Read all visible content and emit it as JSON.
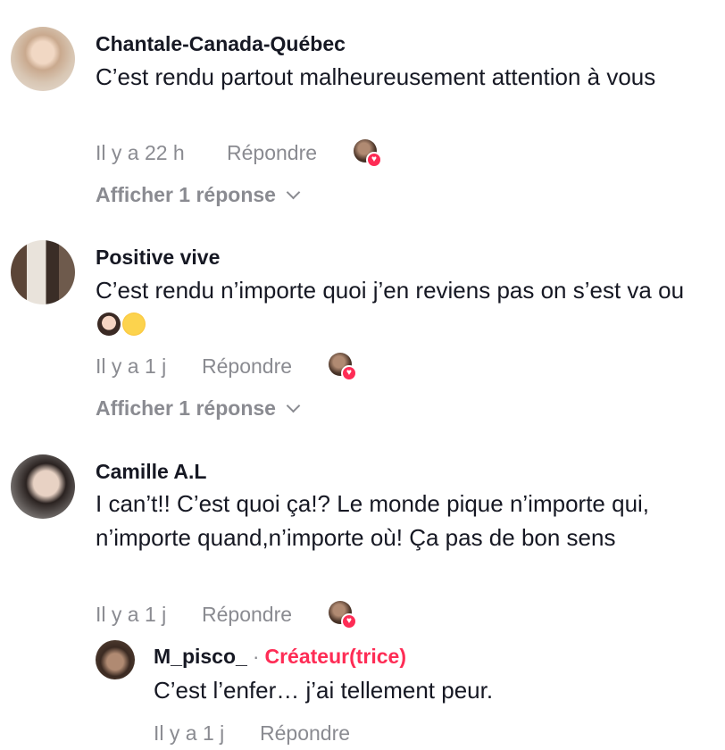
{
  "comments": [
    {
      "username": "Chantale-Canada-Québec",
      "text": "C’est rendu partout malheureusement attention à vous",
      "time": "Il y a 22 h",
      "reply": "Répondre",
      "view_replies": "Afficher 1 réponse"
    },
    {
      "username": "Positive vive",
      "text": "C’est rendu n’importe quoi j’en reviens pas on s’est va ou",
      "emojis": [
        "woman-facepalming-emoji",
        "disappointed-face-emoji"
      ],
      "time": "Il y a 1 j",
      "reply": "Répondre",
      "view_replies": "Afficher 1 réponse"
    },
    {
      "username": "Camille A.L",
      "text": "I can’t!! C’est quoi ça!? Le monde pique n’importe qui, n’importe quand,n’importe où! Ça pas de bon sens",
      "time": "Il y a 1 j",
      "reply": "Répondre"
    }
  ],
  "reply": {
    "username": "M_pisco_",
    "separator": "·",
    "badge": "Créateur(trice)",
    "text": "C’est l’enfer… j’ai tellement peur.",
    "time": "Il y a 1 j",
    "reply": "Répondre"
  },
  "colors": {
    "text": "#161823",
    "muted": "#8a8b91",
    "accent": "#fe2c55"
  }
}
